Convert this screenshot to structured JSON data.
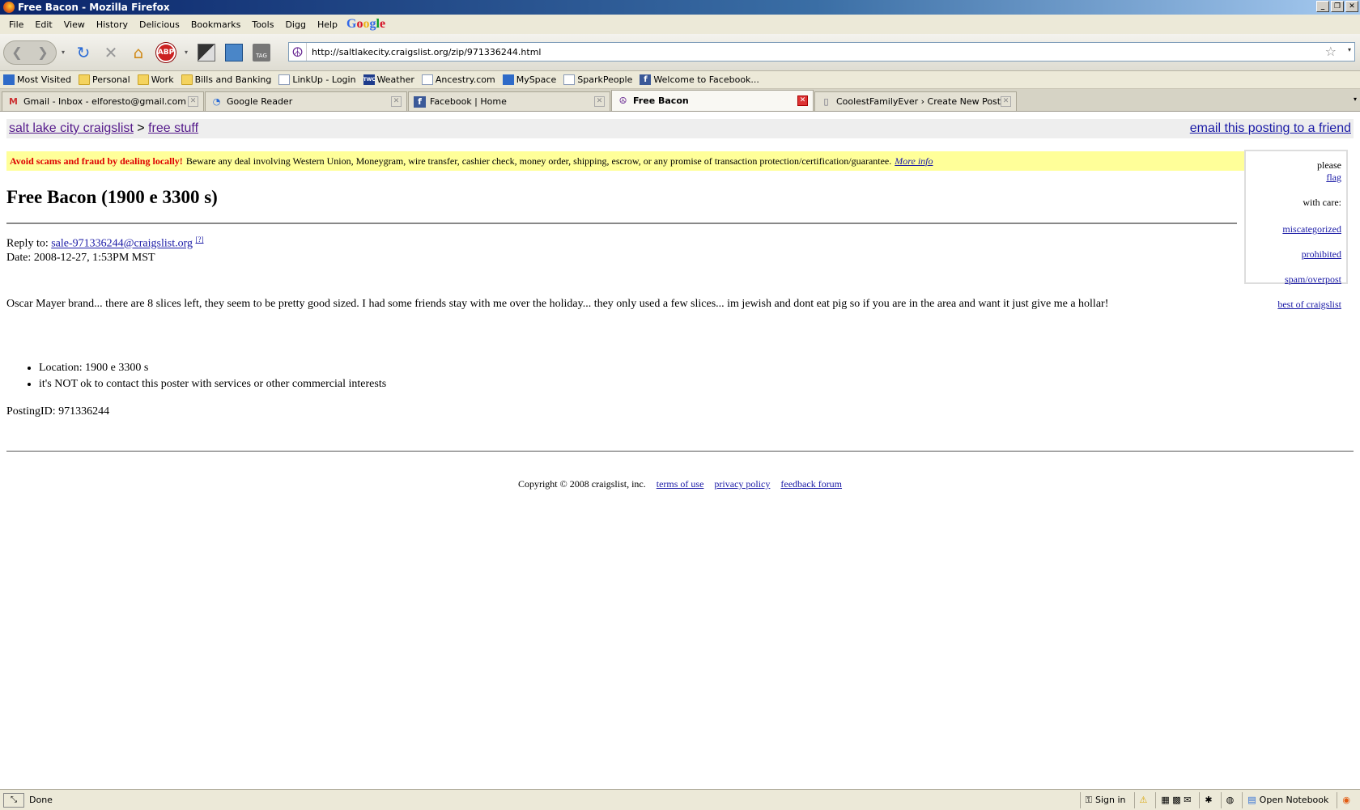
{
  "window": {
    "title": "Free Bacon - Mozilla Firefox"
  },
  "menu": {
    "items": [
      "File",
      "Edit",
      "View",
      "History",
      "Delicious",
      "Bookmarks",
      "Tools",
      "Digg",
      "Help"
    ],
    "google": [
      "G",
      "o",
      "o",
      "g",
      "l",
      "e"
    ]
  },
  "nav": {
    "url": "http://saltlakecity.craigslist.org/zip/971336244.html",
    "adblock_label": "ABP",
    "tag_label": "TAG"
  },
  "bookmarks": [
    {
      "label": "Most Visited",
      "icon": "blue"
    },
    {
      "label": "Personal",
      "icon": "folder"
    },
    {
      "label": "Work",
      "icon": "folder"
    },
    {
      "label": "Bills and Banking",
      "icon": "folder"
    },
    {
      "label": "LinkUp - Login",
      "icon": "page"
    },
    {
      "label": "Weather",
      "icon": "twc"
    },
    {
      "label": "Ancestry.com",
      "icon": "page"
    },
    {
      "label": "MySpace",
      "icon": "blue"
    },
    {
      "label": "SparkPeople",
      "icon": "page"
    },
    {
      "label": "Welcome to Facebook...",
      "icon": "fb"
    }
  ],
  "tabs": [
    {
      "label": "Gmail - Inbox - elforesto@gmail.com",
      "icon": "M",
      "active": false
    },
    {
      "label": "Google Reader",
      "icon": "◔",
      "active": false
    },
    {
      "label": "Facebook | Home",
      "icon": "f",
      "active": false
    },
    {
      "label": "Free Bacon",
      "icon": "☮",
      "active": true
    },
    {
      "label": "CoolestFamilyEver › Create New Post ...",
      "icon": "▯",
      "active": false
    }
  ],
  "page": {
    "crumb_site": "salt lake city craigslist",
    "crumb_sep": " > ",
    "crumb_section": "free stuff",
    "email_friend": "email this posting to a friend",
    "scam_warning": "Avoid scams and fraud by dealing locally!",
    "scam_text": "Beware any deal involving Western Union, Moneygram, wire transfer, cashier check, money order, shipping, escrow, or any promise of transaction protection/certification/guarantee.",
    "scam_more": "More info",
    "flag_prefix": "please",
    "flag_link": "flag",
    "flag_suffix": "with care:",
    "flag_options": [
      "miscategorized",
      "prohibited",
      "spam/overpost",
      "best of craigslist"
    ],
    "title": "Free Bacon (1900 e 3300 s)",
    "reply_label": "Reply to:",
    "reply_email": "sale-971336244@craigslist.org",
    "reply_sup": "[?]",
    "date": "Date: 2008-12-27,  1:53PM MST",
    "body": "Oscar Mayer brand... there are 8 slices left, they seem to be pretty good sized. I had some friends stay with me over the holiday... they only used a few slices... im jewish and dont eat pig so if you are in the area and want it just give me a hollar!",
    "attributes": [
      "Location: 1900 e 3300 s",
      "it's NOT ok to contact this poster with services or other commercial interests"
    ],
    "posting_id": "PostingID: 971336244",
    "copyright": "Copyright © 2008 craigslist, inc.",
    "footer_links": [
      "terms of use",
      "privacy policy",
      "feedback forum"
    ]
  },
  "status": {
    "text": "Done",
    "sign_in": "Sign in",
    "notebook": "Open Notebook"
  }
}
